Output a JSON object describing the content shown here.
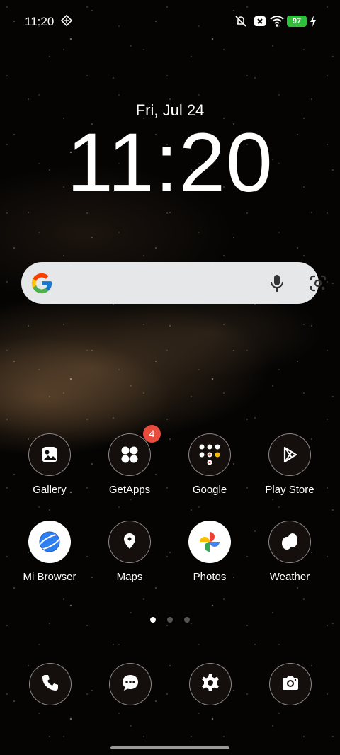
{
  "status": {
    "time": "11:20",
    "battery": "97"
  },
  "lockinfo": {
    "date": "Fri, Jul 24",
    "clock": "11:20"
  },
  "apps": [
    {
      "label": "Gallery"
    },
    {
      "label": "GetApps",
      "badge": "4"
    },
    {
      "label": "Google"
    },
    {
      "label": "Play Store"
    },
    {
      "label": "Mi Browser"
    },
    {
      "label": "Maps"
    },
    {
      "label": "Photos"
    },
    {
      "label": "Weather"
    }
  ],
  "pager": {
    "pages": 3,
    "current": 1
  }
}
